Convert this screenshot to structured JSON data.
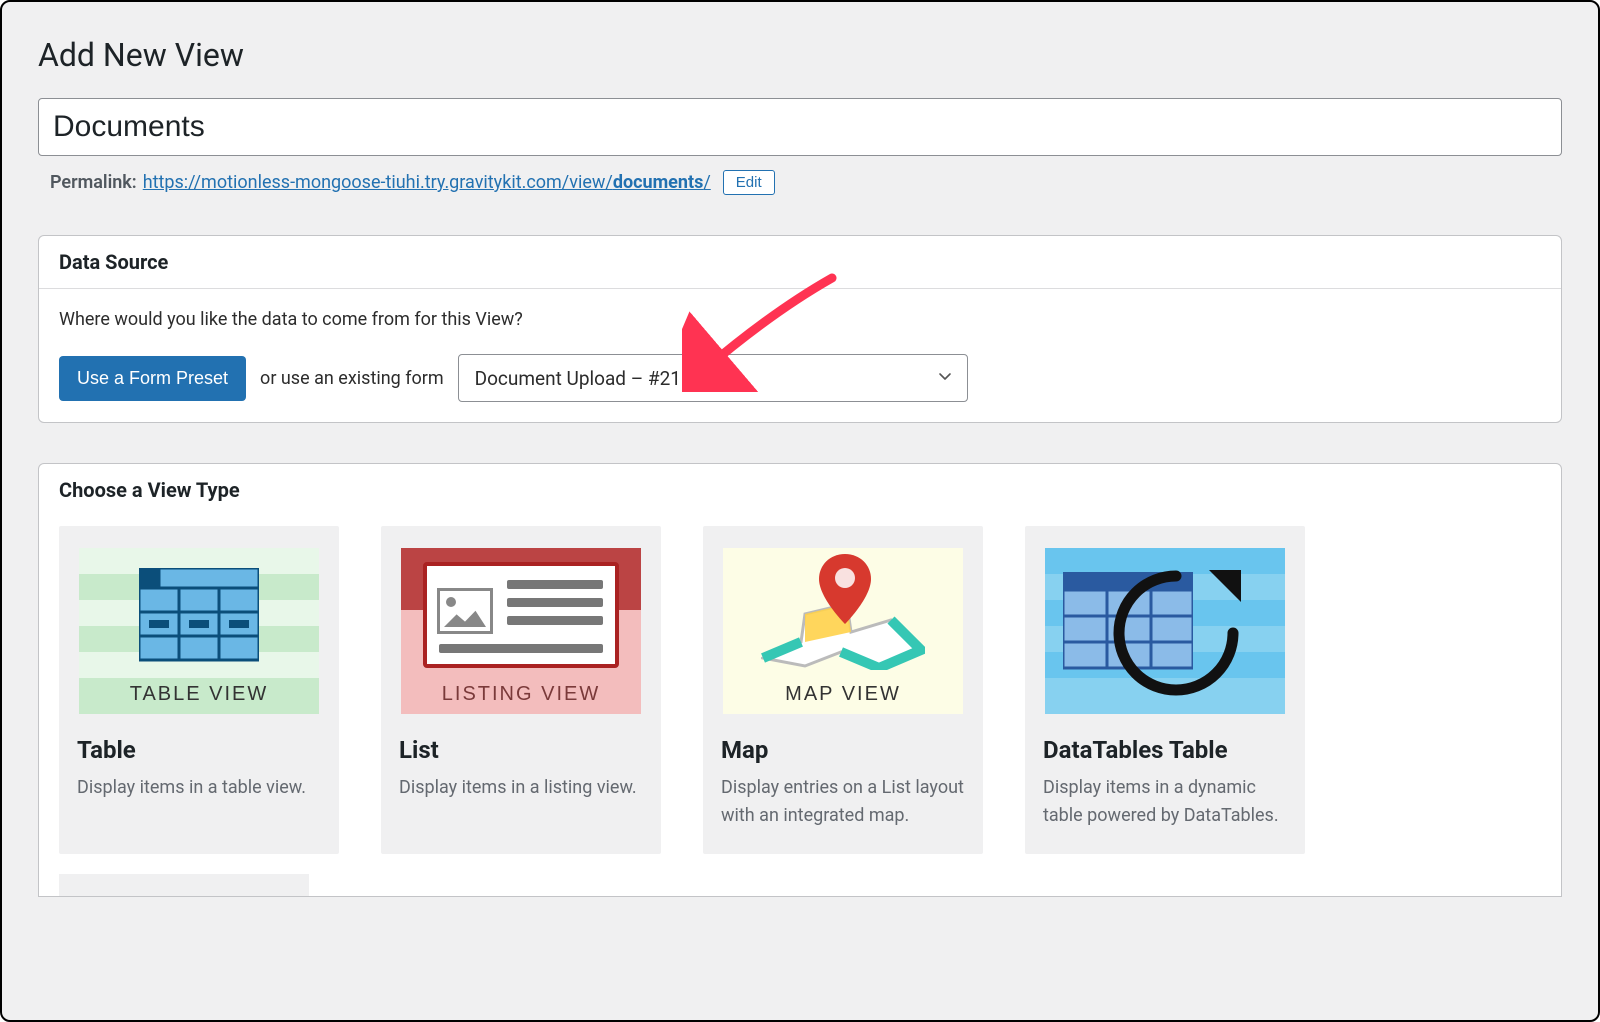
{
  "page": {
    "title": "Add New View"
  },
  "title_field": {
    "value": "Documents"
  },
  "permalink": {
    "label": "Permalink:",
    "url_prefix": "https://motionless-mongoose-tiuhi.try.gravitykit.com/view/",
    "slug": "documents",
    "trail": "/",
    "edit_label": "Edit"
  },
  "data_source": {
    "heading": "Data Source",
    "question": "Where would you like the data to come from for this View?",
    "preset_button": "Use a Form Preset",
    "or_text": "or use an existing form",
    "selected_form": "Document Upload – #21"
  },
  "view_type": {
    "heading": "Choose a View Type",
    "cards": [
      {
        "title": "Table",
        "desc": "Display items in a table view.",
        "caption": "TABLE VIEW"
      },
      {
        "title": "List",
        "desc": "Display items in a listing view.",
        "caption": "LISTING VIEW"
      },
      {
        "title": "Map",
        "desc": "Display entries on a List layout with an integrated map.",
        "caption": "MAP VIEW"
      },
      {
        "title": "DataTables Table",
        "desc": "Display items in a dynamic table powered by DataTables.",
        "caption": ""
      }
    ]
  }
}
